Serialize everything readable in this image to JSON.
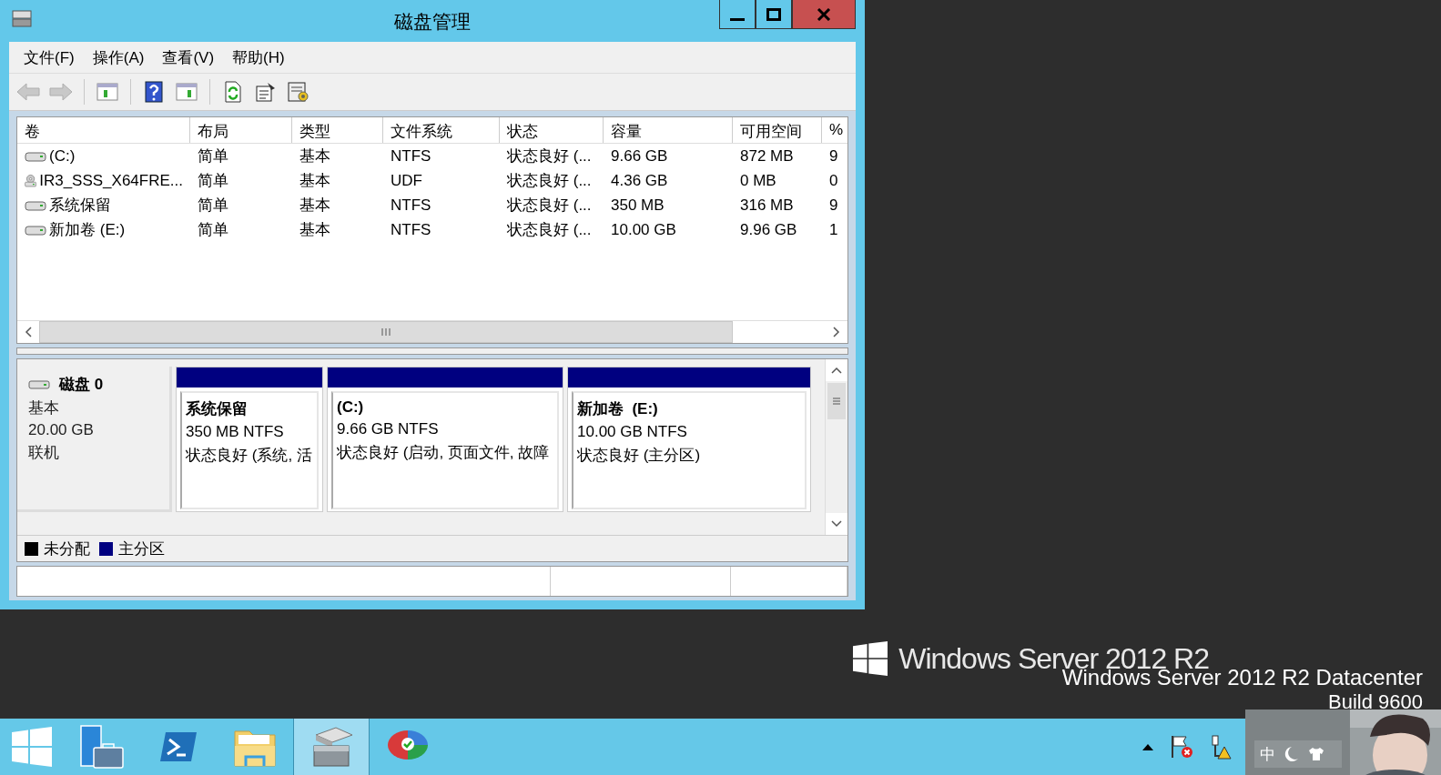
{
  "window": {
    "title": "磁盘管理"
  },
  "menu": [
    "文件(F)",
    "操作(A)",
    "查看(V)",
    "帮助(H)"
  ],
  "toolbar": [
    {
      "kind": "back",
      "disabled": true
    },
    {
      "kind": "forward",
      "disabled": true
    },
    {
      "kind": "tree",
      "disabled": false
    },
    {
      "kind": "help",
      "disabled": false
    },
    {
      "kind": "pane",
      "disabled": false
    },
    {
      "kind": "refresh",
      "disabled": false
    },
    {
      "kind": "properties",
      "disabled": false
    },
    {
      "kind": "settings",
      "disabled": false
    }
  ],
  "volume_table": {
    "columns": [
      "卷",
      "布局",
      "类型",
      "文件系统",
      "状态",
      "容量",
      "可用空间",
      "%"
    ],
    "rows": [
      {
        "kind": "disk",
        "cells": [
          "(C:)",
          "简单",
          "基本",
          "NTFS",
          "状态良好 (...",
          "9.66 GB",
          "872 MB",
          "9"
        ]
      },
      {
        "kind": "cd",
        "cells": [
          "IR3_SSS_X64FRE...",
          "简单",
          "基本",
          "UDF",
          "状态良好 (...",
          "4.36 GB",
          "0 MB",
          "0"
        ]
      },
      {
        "kind": "disk",
        "cells": [
          "系统保留",
          "简单",
          "基本",
          "NTFS",
          "状态良好 (...",
          "350 MB",
          "316 MB",
          "9"
        ]
      },
      {
        "kind": "disk",
        "cells": [
          "新加卷 (E:)",
          "简单",
          "基本",
          "NTFS",
          "状态良好 (...",
          "10.00 GB",
          "9.96 GB",
          "1"
        ]
      }
    ]
  },
  "disks": [
    {
      "name": "磁盘 0",
      "type": "基本",
      "size": "20.00 GB",
      "status": "联机",
      "partitions": [
        {
          "title": "系统保留",
          "size": "350 MB NTFS",
          "status": "状态良好 (系统, 活",
          "color": "#000080"
        },
        {
          "title": "(C:)",
          "size": "9.66 GB NTFS",
          "status": "状态良好 (启动, 页面文件, 故障",
          "color": "#000080"
        },
        {
          "title": "新加卷  (E:)",
          "size": "10.00 GB NTFS",
          "status": "状态良好 (主分区)",
          "color": "#000080"
        }
      ]
    }
  ],
  "legend": [
    {
      "label": "未分配",
      "color": "#000000"
    },
    {
      "label": "主分区",
      "color": "#000080"
    }
  ],
  "desktop": {
    "logo_text": "Windows Server 2012 R2",
    "edition": "Windows Server 2012 R2 Datacenter",
    "build": "Build 9600"
  },
  "taskbar": {
    "apps": [
      {
        "kind": "start",
        "selected": false
      },
      {
        "kind": "server",
        "selected": false
      },
      {
        "kind": "shell",
        "selected": false
      },
      {
        "kind": "folder",
        "selected": false
      },
      {
        "kind": "diskmgmt",
        "selected": true
      },
      {
        "kind": "partition",
        "selected": false
      }
    ],
    "ime": {
      "mode": "中"
    }
  }
}
